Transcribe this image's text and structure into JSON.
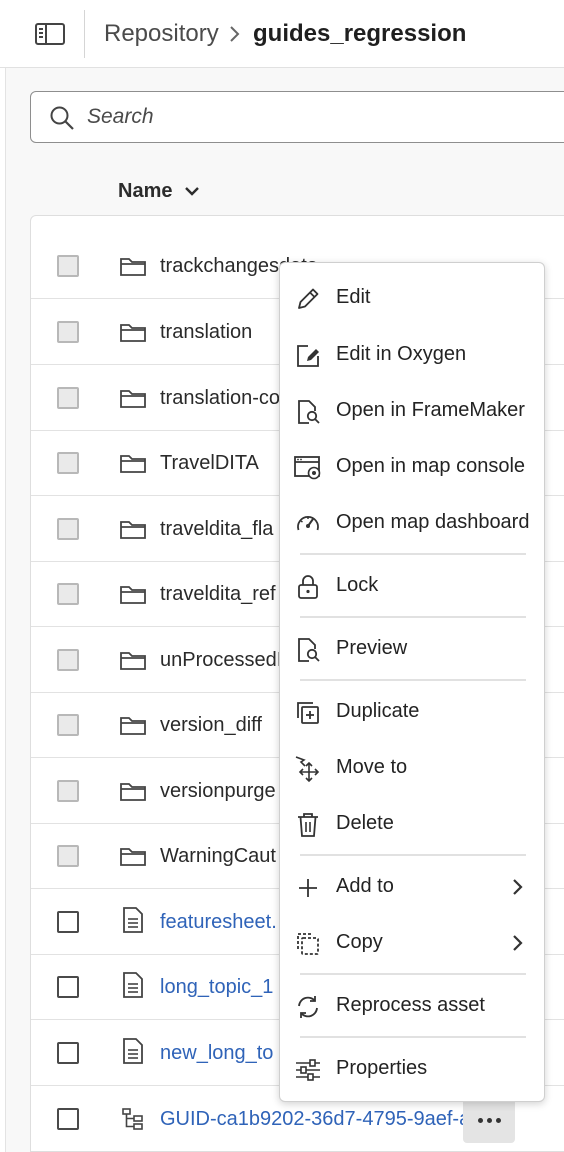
{
  "breadcrumb": {
    "root": "Repository",
    "current": "guides_regression"
  },
  "search": {
    "placeholder": "Search",
    "value": ""
  },
  "table": {
    "column_header": "Name",
    "rows": [
      {
        "name": "trackchangesdata",
        "type": "folder"
      },
      {
        "name": "translation",
        "type": "folder"
      },
      {
        "name": "translation-co",
        "type": "folder"
      },
      {
        "name": "TravelDITA",
        "type": "folder"
      },
      {
        "name": "traveldita_fla",
        "type": "folder"
      },
      {
        "name": "traveldita_ref",
        "type": "folder"
      },
      {
        "name": "unProcessedI",
        "type": "folder"
      },
      {
        "name": "version_diff",
        "type": "folder"
      },
      {
        "name": "versionpurge",
        "type": "folder"
      },
      {
        "name": "WarningCaut",
        "type": "folder"
      },
      {
        "name": "featuresheet.",
        "type": "file"
      },
      {
        "name": "long_topic_1",
        "type": "file"
      },
      {
        "name": "new_long_to",
        "type": "file"
      },
      {
        "name": "GUID-ca1b9202-36d7-4795-9aef-a...",
        "type": "map"
      }
    ]
  },
  "context_menu": {
    "items": [
      {
        "label": "Edit",
        "icon": "pencil-icon"
      },
      {
        "label": "Edit in Oxygen",
        "icon": "edit-in-icon"
      },
      {
        "label": "Open in FrameMaker",
        "icon": "file-search-icon"
      },
      {
        "label": "Open in map console",
        "icon": "map-console-icon"
      },
      {
        "label": "Open map dashboard",
        "icon": "gauge-icon"
      },
      {
        "label": "Lock",
        "icon": "lock-icon"
      },
      {
        "label": "Preview",
        "icon": "preview-icon"
      },
      {
        "label": "Duplicate",
        "icon": "duplicate-icon"
      },
      {
        "label": "Move to",
        "icon": "move-icon"
      },
      {
        "label": "Delete",
        "icon": "trash-icon"
      },
      {
        "label": "Add to",
        "icon": "plus-icon",
        "submenu": true
      },
      {
        "label": "Copy",
        "icon": "copy-icon",
        "submenu": true
      },
      {
        "label": "Reprocess asset",
        "icon": "refresh-icon"
      },
      {
        "label": "Properties",
        "icon": "sliders-icon"
      }
    ]
  },
  "colors": {
    "link": "#2f63b8",
    "text": "#222222",
    "border": "#dedede"
  }
}
